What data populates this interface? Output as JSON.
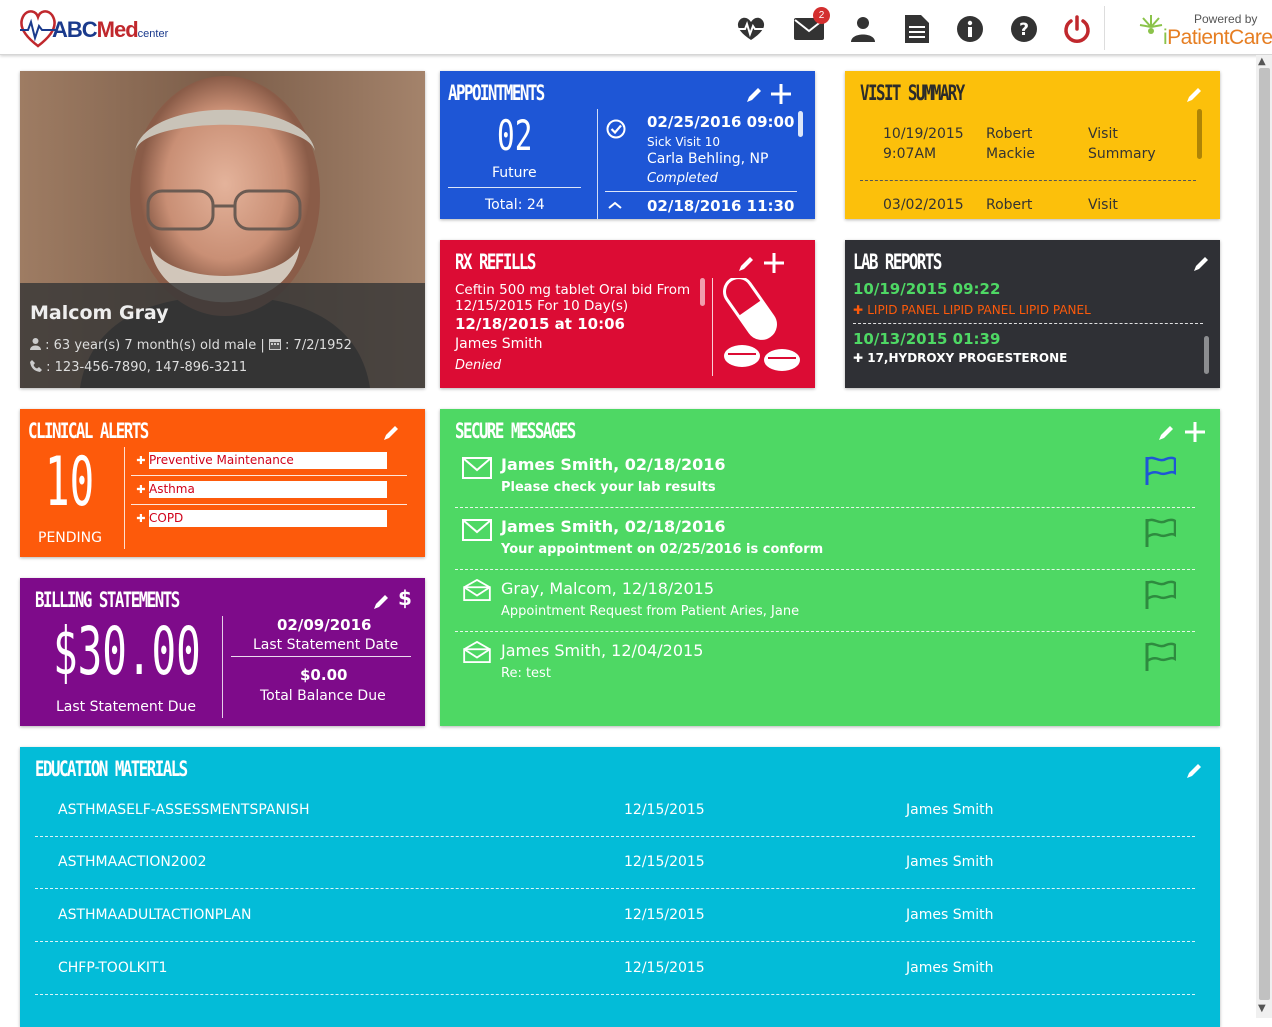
{
  "header": {
    "logo": {
      "abc": "ABC",
      "med": "Med",
      "center": "center"
    },
    "nav_icons": [
      "heartbeat-icon",
      "mail-icon",
      "user-icon",
      "document-icon",
      "info-icon",
      "help-icon",
      "power-icon"
    ],
    "mail_badge": "2",
    "powered_by": "Powered by",
    "brand": {
      "i": "i",
      "rest": "PatientCare"
    }
  },
  "patient": {
    "name": "Malcom Gray",
    "age": ": 63 year(s) 7 month(s) old male",
    "separator": "|",
    "dob": ": 7/2/1952",
    "phones": ": 123-456-7890, 147-896-3211"
  },
  "appointments": {
    "title": "Appointments",
    "count": "02",
    "count_label": "Future",
    "total_label": "Total:",
    "total_value": "24",
    "items": [
      {
        "datetime": "02/25/2016 09:00",
        "type": "Sick Visit 10",
        "provider": "Carla Behling, NP",
        "status": "Completed"
      },
      {
        "datetime": "02/18/2016 11:30"
      }
    ]
  },
  "visit_summary": {
    "title": "Visit Summary",
    "rows": [
      {
        "date": "10/19/2015",
        "time": "9:07AM",
        "first": "Robert",
        "last": "Mackie",
        "doc1": "Visit",
        "doc2": "Summary"
      },
      {
        "date": "03/02/2015",
        "first": "Robert",
        "doc1": "Visit"
      }
    ]
  },
  "rx_refills": {
    "title": "Rx Refills",
    "line1": "Ceftin 500 mg tablet Oral bid From",
    "line2": "12/15/2015 For 10 Day(s)",
    "datetime": "12/18/2015 at 10:06",
    "provider": "James Smith",
    "status": "Denied"
  },
  "lab_reports": {
    "title": "Lab Reports",
    "items": [
      {
        "datetime": "10/19/2015 09:22",
        "test": "LIPID PANEL LIPID PANEL LIPID PANEL"
      },
      {
        "datetime": "10/13/2015 01:39",
        "test": "17,HYDROXY PROGESTERONE"
      }
    ]
  },
  "clinical_alerts": {
    "title": "Clinical Alerts",
    "count": "10",
    "count_label": "PENDING",
    "items": [
      "Preventive Maintenance",
      "Asthma",
      "COPD"
    ]
  },
  "secure_messages": {
    "title": "Secure Messages",
    "items": [
      {
        "from": "James Smith, 02/18/2016",
        "subject": "Please check your lab results",
        "unread": true,
        "flagged": true
      },
      {
        "from": "James Smith, 02/18/2016",
        "subject": "Your appointment on 02/25/2016 is conform",
        "unread": true,
        "flagged": false
      },
      {
        "from": "Gray, Malcom, 12/18/2015",
        "subject": "Appointment Request from Patient Aries, Jane",
        "unread": false,
        "flagged": false
      },
      {
        "from": "James Smith, 12/04/2015",
        "subject": "Re: test",
        "unread": false,
        "flagged": false
      }
    ]
  },
  "billing": {
    "title": "Billing Statements",
    "amount": "$30.00",
    "amount_label": "Last Statement Due",
    "statement_date": "02/09/2016",
    "statement_date_label": "Last Statement Date",
    "balance": "$0.00",
    "balance_label": "Total Balance Due"
  },
  "education": {
    "title": "Education Materials",
    "rows": [
      {
        "name": "ASTHMASELF-ASSESSMENTSPANISH",
        "date": "12/15/2015",
        "provider": "James Smith"
      },
      {
        "name": "ASTHMAACTION2002",
        "date": "12/15/2015",
        "provider": "James Smith"
      },
      {
        "name": "ASTHMAADULTACTIONPLAN",
        "date": "12/15/2015",
        "provider": "James Smith"
      },
      {
        "name": "CHFP-TOOLKIT1",
        "date": "12/15/2015",
        "provider": "James Smith"
      }
    ]
  },
  "colors": {
    "appointments": "#1e56d6",
    "visit_summary": "#fcc00b",
    "rx_refills": "#dc0c34",
    "lab_reports": "#2f3035",
    "clinical_alerts": "#fd5a0b",
    "secure_messages": "#4ed864",
    "billing": "#7e0b8a",
    "education": "#03bcd8",
    "lab_date": "#4ed864",
    "lab_test": "#fd5a0b"
  }
}
